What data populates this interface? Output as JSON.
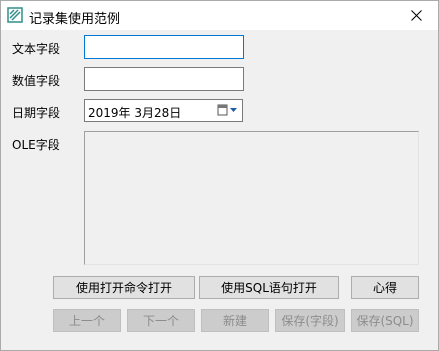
{
  "window": {
    "title": "记录集使用范例",
    "close_glyph": "✕"
  },
  "fields": {
    "text_label": "文本字段",
    "text_value": "",
    "number_label": "数值字段",
    "number_value": "",
    "date_label": "日期字段",
    "date_value": "2019年  3月28日",
    "ole_label": "OLE字段"
  },
  "buttons": {
    "open_cmd": "使用打开命令打开",
    "open_sql": "使用SQL语句打开",
    "notes": "心得",
    "prev": "上一个",
    "next": "下一个",
    "new": "新建",
    "save_field": "保存(字段)",
    "save_sql": "保存(SQL)"
  },
  "colors": {
    "focus_border": "#0078d7",
    "icon_teal": "#2f8f8a"
  }
}
